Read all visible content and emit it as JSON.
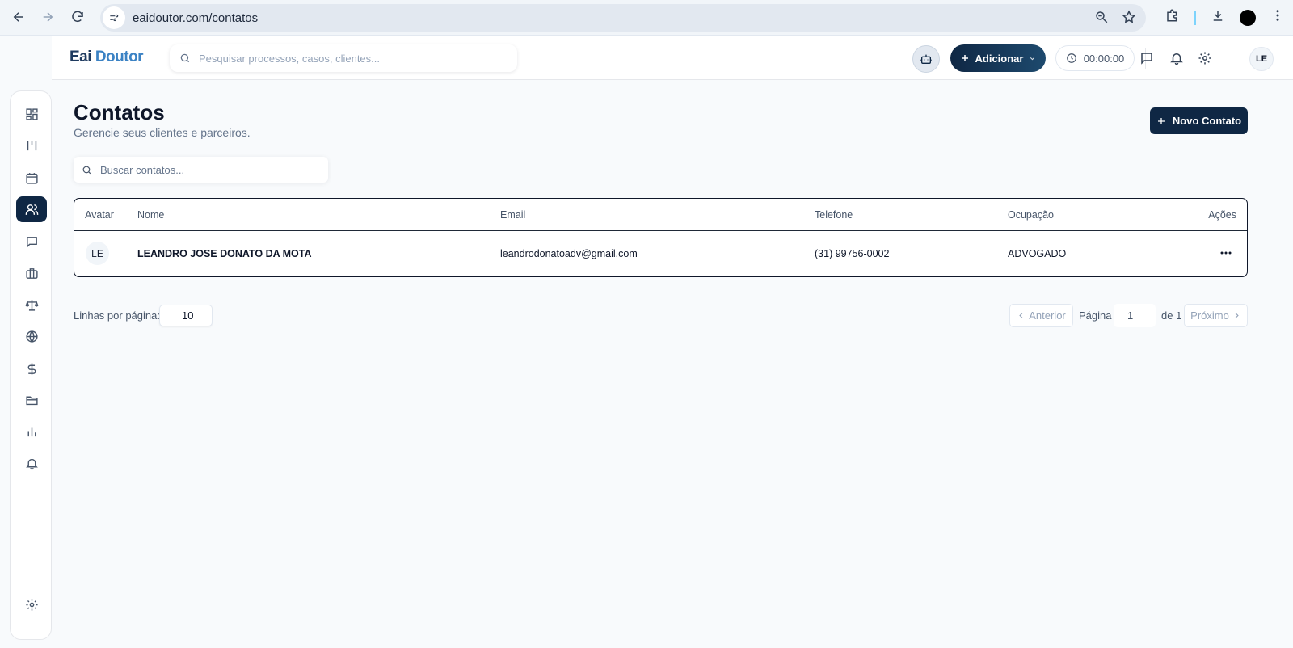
{
  "browser": {
    "url": "eaidoutor.com/contatos"
  },
  "header": {
    "logo_part1": "Eai",
    "logo_part2": "Doutor",
    "search_placeholder": "Pesquisar processos, casos, clientes...",
    "add_label": "Adicionar",
    "timer": "00:00:00",
    "avatar": "LE"
  },
  "sidebar": {
    "items": [
      {
        "icon": "dashboard-icon"
      },
      {
        "icon": "kanban-icon"
      },
      {
        "icon": "calendar-icon"
      },
      {
        "icon": "contacts-icon",
        "active": true
      },
      {
        "icon": "chat-icon"
      },
      {
        "icon": "briefcase-icon"
      },
      {
        "icon": "scale-icon"
      },
      {
        "icon": "globe-icon"
      },
      {
        "icon": "dollar-icon"
      },
      {
        "icon": "folder-icon"
      },
      {
        "icon": "chart-icon"
      },
      {
        "icon": "bell-icon"
      }
    ],
    "footer_icon": "settings-icon"
  },
  "page": {
    "title": "Contatos",
    "subtitle": "Gerencie seus clientes e parceiros.",
    "new_contact_label": "Novo Contato",
    "search_placeholder": "Buscar contatos..."
  },
  "table": {
    "columns": [
      "Avatar",
      "Nome",
      "Email",
      "Telefone",
      "Ocupação",
      "Ações"
    ],
    "rows": [
      {
        "avatar": "LE",
        "name": "LEANDRO JOSE DONATO DA MOTA",
        "email": "leandrodonatoadv@gmail.com",
        "phone": "(31) 99756-0002",
        "occupation": "ADVOGADO"
      }
    ]
  },
  "pagination": {
    "rows_label": "Linhas por página:",
    "rows_value": "10",
    "prev_label": "Anterior",
    "page_label": "Página",
    "page_value": "1",
    "of_label": "de 1",
    "next_label": "Próximo"
  },
  "colors": {
    "primary": "#0f2744",
    "accent": "#3b82c4",
    "background": "#f8fafc"
  }
}
